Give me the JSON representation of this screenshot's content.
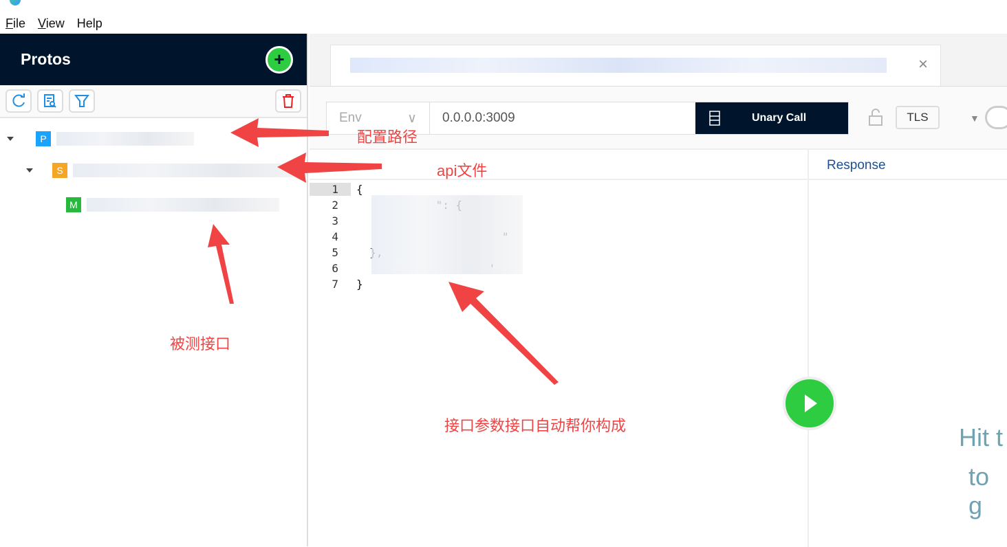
{
  "menu": [
    {
      "label": "File",
      "accel": "F",
      "rest": "ile"
    },
    {
      "label": "View",
      "accel": "V",
      "rest": "iew"
    },
    {
      "label": "Help"
    }
  ],
  "sidebar": {
    "title": "Protos",
    "add_icon": "plus-icon",
    "tools": [
      "refresh-icon",
      "file-search-icon",
      "filter-icon"
    ],
    "delete_icon": "trash-icon",
    "tree": [
      {
        "tag": "P",
        "color": "#1aa3ff"
      },
      {
        "tag": "S",
        "color": "#f5a623"
      },
      {
        "tag": "M",
        "color": "#27b83e"
      }
    ]
  },
  "toolbar": {
    "env_placeholder": "Env",
    "address": "0.0.0.0:3009",
    "call_type": "Unary Call",
    "tls": "TLS"
  },
  "response": {
    "label": "Response",
    "hint_line1": "Hit t",
    "hint_line2": "to g"
  },
  "editor": {
    "lines": [
      {
        "n": "1",
        "code": "{"
      },
      {
        "n": "2",
        "code": "            \": {"
      },
      {
        "n": "3",
        "code": ""
      },
      {
        "n": "4",
        "code": "                      \""
      },
      {
        "n": "5",
        "code": "  },"
      },
      {
        "n": "6",
        "code": "                    '"
      },
      {
        "n": "7",
        "code": "}"
      }
    ]
  },
  "annotations": {
    "path": "配置路径",
    "api": "api文件",
    "method": "被测接口",
    "params": "接口参数接口自动帮你构成"
  },
  "colors": {
    "header": "#00152b",
    "accent": "#2ecc40",
    "annotation": "#f04444"
  }
}
